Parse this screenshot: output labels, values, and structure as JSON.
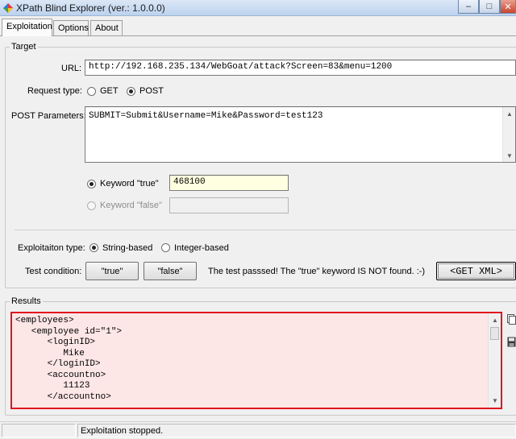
{
  "window": {
    "title": "XPath Blind Explorer (ver.: 1.0.0.0)"
  },
  "tabs": [
    {
      "label": "Exploitation"
    },
    {
      "label": "Options"
    },
    {
      "label": "About"
    }
  ],
  "target": {
    "group_title": "Target",
    "url_label": "URL:",
    "url_value": "http://192.168.235.134/WebGoat/attack?Screen=83&menu=1200",
    "request_type_label": "Request type:",
    "request_types": [
      "GET",
      "POST"
    ],
    "request_type_selected": "POST",
    "post_params_label": "POST Parameters:",
    "post_params_value": "SUBMIT=Submit&Username=Mike&Password=test123",
    "keyword_true_label": "Keyword \"true\"",
    "keyword_true_value": "468100",
    "keyword_false_label": "Keyword \"false\"",
    "keyword_false_value": "",
    "keyword_selected": "true",
    "exploitation_type_label": "Exploitaiton type:",
    "exploitation_types": [
      "String-based",
      "Integer-based"
    ],
    "exploitation_type_selected": "String-based",
    "test_condition_label": "Test condition:",
    "test_true_button": "\"true\"",
    "test_false_button": "\"false\"",
    "test_result_text": "The test passsed! The \"true\" keyword IS NOT found. :-)",
    "get_xml_button": "<GET XML>"
  },
  "results": {
    "group_title": "Results",
    "lines": [
      "<employees>",
      "   <employee id=\"1\">",
      "      <loginID>",
      "         Mike",
      "      </loginID>",
      "      <accountno>",
      "         11123",
      "      </accountno>"
    ],
    "highlight_color": "#e0141e",
    "background_color": "#fde6e6"
  },
  "side_icons": [
    "copy-icon",
    "save-icon"
  ],
  "status": {
    "text": "Exploitation stopped."
  }
}
